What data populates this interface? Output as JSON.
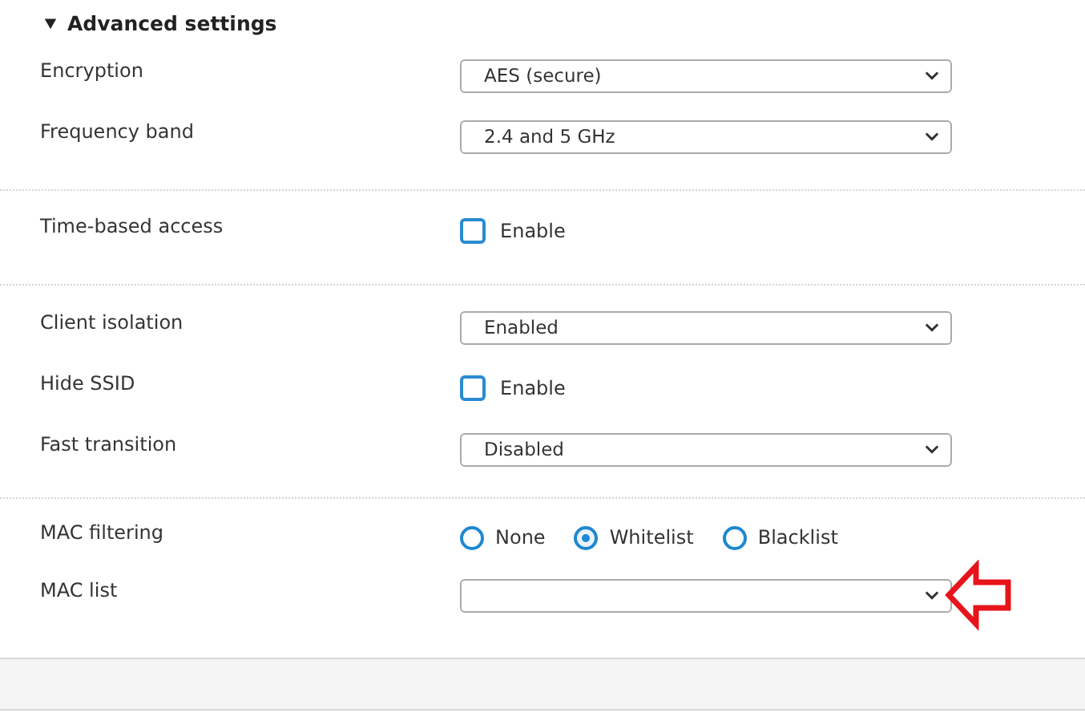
{
  "section": {
    "title": "Advanced settings",
    "expanded": true
  },
  "groups": [
    {
      "rows": [
        {
          "kind": "select",
          "label": "Encryption",
          "value": "AES (secure)"
        },
        {
          "kind": "select",
          "label": "Frequency band",
          "value": "2.4 and 5 GHz"
        }
      ]
    },
    {
      "rows": [
        {
          "kind": "checkbox",
          "label": "Time-based access",
          "option": "Enable",
          "checked": false
        }
      ]
    },
    {
      "rows": [
        {
          "kind": "select",
          "label": "Client isolation",
          "value": "Enabled"
        },
        {
          "kind": "checkbox",
          "label": "Hide SSID",
          "option": "Enable",
          "checked": false
        },
        {
          "kind": "select",
          "label": "Fast transition",
          "value": "Disabled"
        }
      ]
    },
    {
      "rows": [
        {
          "kind": "radio",
          "label": "MAC filtering",
          "options": [
            {
              "label": "None",
              "selected": false
            },
            {
              "label": "Whitelist",
              "selected": true
            },
            {
              "label": "Blacklist",
              "selected": false
            }
          ]
        },
        {
          "kind": "select",
          "label": "MAC list",
          "value": "",
          "pointed": true
        }
      ]
    }
  ]
}
